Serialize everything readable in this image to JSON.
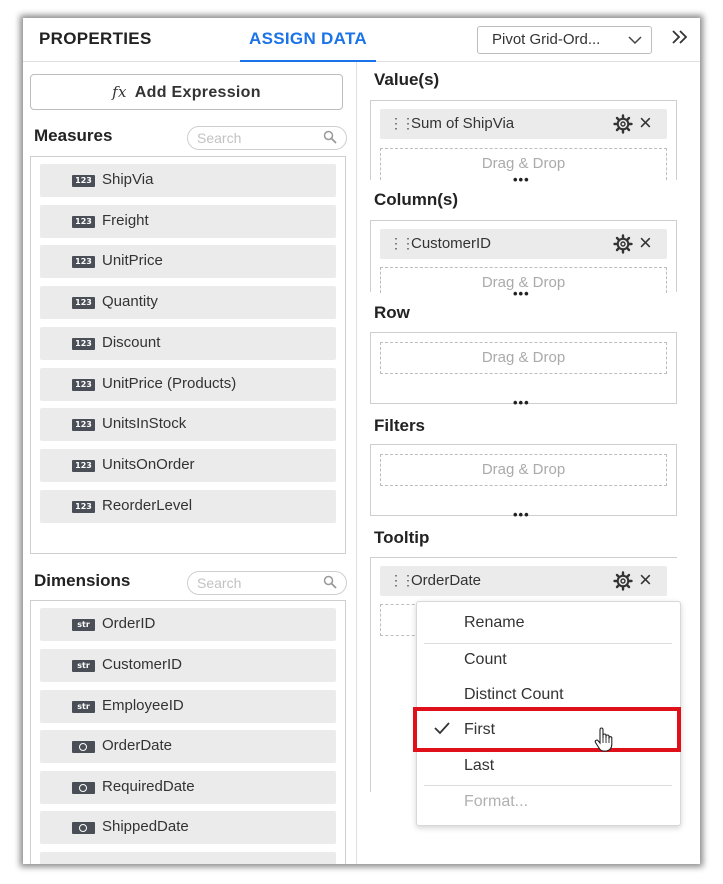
{
  "header": {
    "tabs": {
      "properties": "PROPERTIES",
      "assign_data": "ASSIGN DATA"
    },
    "widget_select": {
      "value": "Pivot Grid-Ord..."
    },
    "expand_icon": "double-chevron-right-icon"
  },
  "left": {
    "add_expression": {
      "icon": "fx",
      "label": "Add Expression"
    },
    "measures": {
      "title": "Measures",
      "search_placeholder": "Search",
      "items": [
        {
          "type": "123",
          "label": "ShipVia"
        },
        {
          "type": "123",
          "label": "Freight"
        },
        {
          "type": "123",
          "label": "UnitPrice"
        },
        {
          "type": "123",
          "label": "Quantity"
        },
        {
          "type": "123",
          "label": "Discount"
        },
        {
          "type": "123",
          "label": "UnitPrice (Products)"
        },
        {
          "type": "123",
          "label": "UnitsInStock"
        },
        {
          "type": "123",
          "label": "UnitsOnOrder"
        },
        {
          "type": "123",
          "label": "ReorderLevel"
        }
      ]
    },
    "dimensions": {
      "title": "Dimensions",
      "search_placeholder": "Search",
      "items": [
        {
          "type": "str",
          "label": "OrderID"
        },
        {
          "type": "str",
          "label": "CustomerID"
        },
        {
          "type": "str",
          "label": "EmployeeID"
        },
        {
          "type": "date",
          "label": "OrderDate"
        },
        {
          "type": "date",
          "label": "RequiredDate"
        },
        {
          "type": "date",
          "label": "ShippedDate"
        }
      ]
    }
  },
  "right": {
    "values": {
      "title": "Value(s)",
      "pill": "Sum of ShipVia",
      "drop": "Drag & Drop"
    },
    "columns": {
      "title": "Column(s)",
      "pill": "CustomerID",
      "drop": "Drag & Drop"
    },
    "row": {
      "title": "Row",
      "drop": "Drag & Drop"
    },
    "filters": {
      "title": "Filters",
      "drop": "Drag & Drop"
    },
    "tooltip": {
      "title": "Tooltip",
      "pill": "OrderDate"
    }
  },
  "context_menu": {
    "items": [
      "Rename",
      "Count",
      "Distinct Count",
      "First",
      "Last",
      "Format..."
    ],
    "selected": "First",
    "disabled": "Format..."
  },
  "colors": {
    "accent": "#1a73e8",
    "highlight": "#e0101a",
    "badge": "#4a4f57"
  }
}
